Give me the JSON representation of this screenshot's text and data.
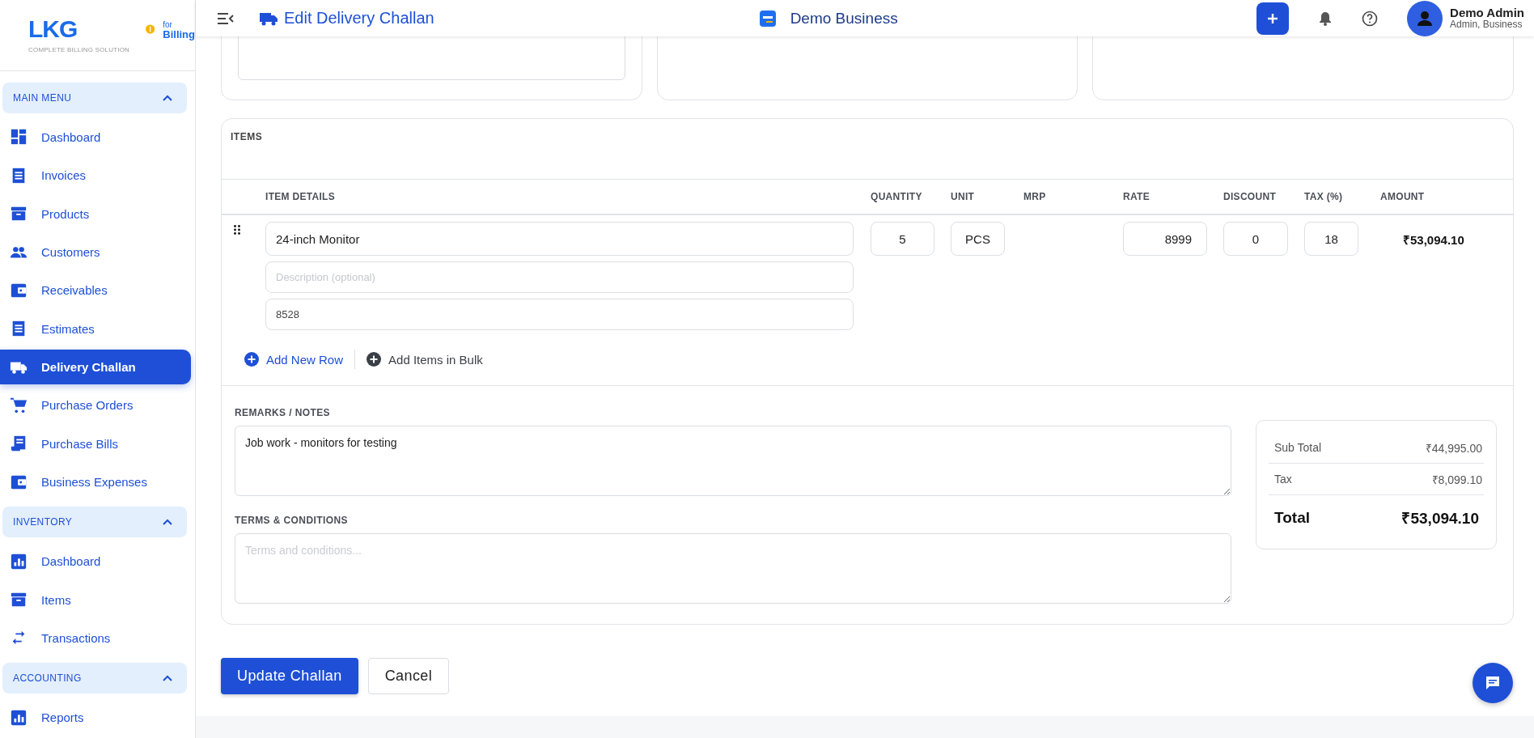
{
  "sidebar": {
    "logo": {
      "brand": "LKG",
      "for": "for",
      "product": "Billing",
      "tagline": "COMPLETE BILLING SOLUTION"
    },
    "sections": [
      {
        "title": "MAIN MENU",
        "expanded": true,
        "items": [
          {
            "label": "Dashboard",
            "selected": false
          },
          {
            "label": "Invoices",
            "selected": false
          },
          {
            "label": "Products",
            "selected": false
          },
          {
            "label": "Customers",
            "selected": false
          },
          {
            "label": "Receivables",
            "selected": false
          },
          {
            "label": "Estimates",
            "selected": false
          },
          {
            "label": "Delivery Challan",
            "selected": true
          },
          {
            "label": "Purchase Orders",
            "selected": false
          },
          {
            "label": "Purchase Bills",
            "selected": false
          },
          {
            "label": "Business Expenses",
            "selected": false
          }
        ]
      },
      {
        "title": "INVENTORY",
        "expanded": true,
        "items": [
          {
            "label": "Dashboard",
            "selected": false
          },
          {
            "label": "Items",
            "selected": false
          },
          {
            "label": "Transactions",
            "selected": false
          }
        ]
      },
      {
        "title": "ACCOUNTING",
        "expanded": true,
        "items": [
          {
            "label": "Reports",
            "selected": false
          }
        ]
      }
    ]
  },
  "header": {
    "title": "Edit Delivery Challan",
    "business": "Demo Business",
    "user": {
      "name": "Demo Admin",
      "role": "Admin, Business"
    }
  },
  "items": {
    "title": "ITEMS",
    "columns": [
      "ITEM DETAILS",
      "QUANTITY",
      "UNIT",
      "MRP",
      "RATE",
      "DISCOUNT",
      "TAX (%)",
      "AMOUNT"
    ],
    "rows": [
      {
        "name": "24-inch Monitor",
        "description_placeholder": "Description (optional)",
        "hsn": "8528",
        "quantity": "5",
        "unit": "PCS",
        "rate": "8999",
        "discount": "0",
        "tax": "18",
        "amount": "₹53,094.10"
      }
    ],
    "actions": [
      {
        "label": "Add New Row",
        "kind": "primary"
      },
      {
        "label": "Add Items in Bulk",
        "kind": "secondary"
      }
    ]
  },
  "notes": {
    "remarks_label": "REMARKS / NOTES",
    "remarks": "Job work - monitors for testing",
    "terms_label": "TERMS & CONDITIONS",
    "terms_placeholder": "Terms and conditions..."
  },
  "totals": [
    {
      "label": "Sub Total",
      "value": "₹44,995.00",
      "kind": "normal"
    },
    {
      "label": "Tax",
      "value": "₹8,099.10",
      "kind": "normal"
    },
    {
      "label": "Total",
      "value": "₹53,094.10",
      "kind": "total"
    }
  ],
  "buttons": [
    {
      "label": "Update Challan",
      "kind": "primary"
    },
    {
      "label": "Cancel",
      "kind": "secondary"
    }
  ]
}
